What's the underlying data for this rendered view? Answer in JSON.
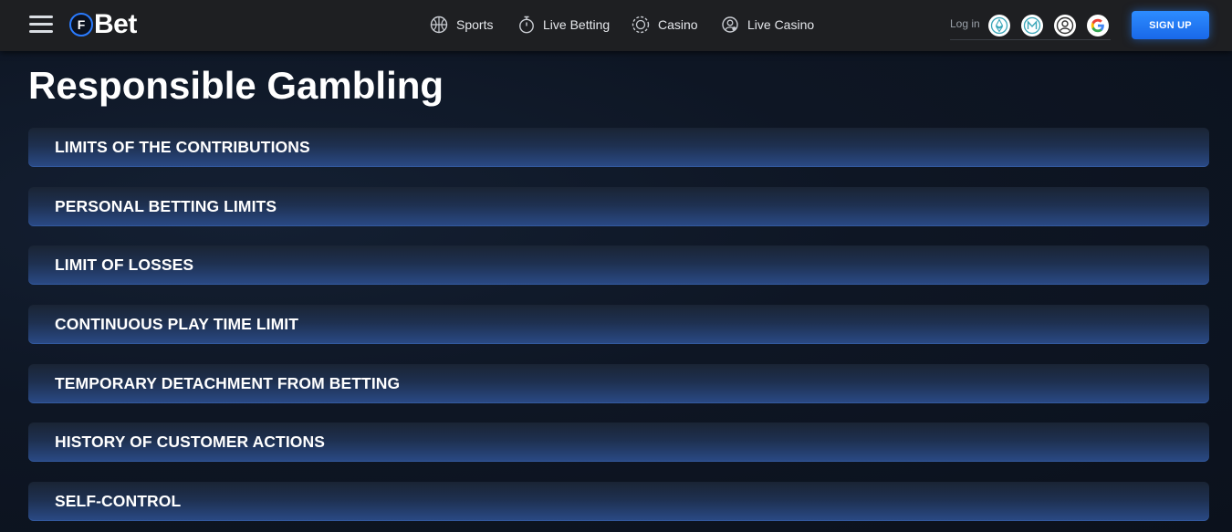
{
  "header": {
    "logo_letter": "F",
    "logo_text": "Bet",
    "nav": [
      {
        "label": "Sports",
        "icon": "basketball-icon"
      },
      {
        "label": "Live Betting",
        "icon": "stopwatch-icon"
      },
      {
        "label": "Casino",
        "icon": "casino-chip-icon"
      },
      {
        "label": "Live Casino",
        "icon": "live-dealer-icon"
      }
    ],
    "login_label": "Log in",
    "social_icons": [
      "ethereum-icon",
      "metamask-icon",
      "user-icon",
      "google-icon"
    ],
    "signup_label": "SIGN UP"
  },
  "page": {
    "title": "Responsible Gambling"
  },
  "accordion": {
    "items": [
      "LIMITS OF THE CONTRIBUTIONS",
      "PERSONAL BETTING LIMITS",
      "LIMIT OF LOSSES",
      "CONTINUOUS PLAY TIME LIMIT",
      "TEMPORARY DETACHMENT FROM BETTING",
      "HISTORY OF CUSTOMER ACTIONS",
      "SELF-CONTROL"
    ]
  },
  "colors": {
    "accent": "#1f72f0",
    "header_bg": "#1e1f22",
    "page_bg": "#0e1624",
    "accordion_bg": "#2a4a86"
  }
}
